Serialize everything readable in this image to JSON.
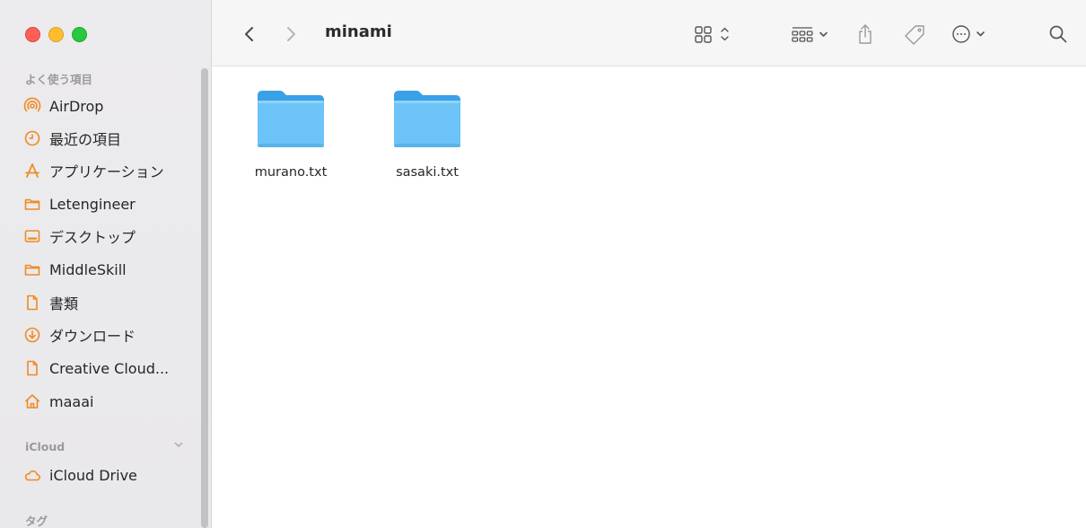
{
  "sidebar": {
    "sections": {
      "favorites": "よく使う項目",
      "icloud": "iCloud",
      "tags": "タグ"
    },
    "favorites": [
      {
        "label": "AirDrop",
        "icon": "airdrop-icon"
      },
      {
        "label": "最近の項目",
        "icon": "clock-icon"
      },
      {
        "label": "アプリケーション",
        "icon": "applications-icon"
      },
      {
        "label": "Letengineer",
        "icon": "folder-icon"
      },
      {
        "label": "デスクトップ",
        "icon": "desktop-icon"
      },
      {
        "label": "MiddleSkill",
        "icon": "folder-icon"
      },
      {
        "label": "書類",
        "icon": "document-icon"
      },
      {
        "label": "ダウンロード",
        "icon": "download-icon"
      },
      {
        "label": "Creative Cloud...",
        "icon": "document-icon"
      },
      {
        "label": "maaai",
        "icon": "home-icon"
      }
    ],
    "icloud": [
      {
        "label": "iCloud Drive",
        "icon": "cloud-icon"
      }
    ]
  },
  "toolbar": {
    "title": "minami"
  },
  "files": [
    {
      "name": "murano.txt",
      "icon": "folder-icon"
    },
    {
      "name": "sasaki.txt",
      "icon": "folder-icon"
    }
  ],
  "colors": {
    "accent": "#f08a24",
    "folder_top": "#3aa0e8",
    "folder_body": "#6cc3f7"
  }
}
